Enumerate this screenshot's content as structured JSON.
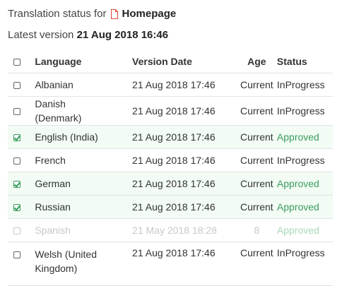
{
  "header": {
    "title_prefix": "Translation status for",
    "page_name": "Homepage",
    "latest_prefix": "Latest version",
    "latest_value": "21 Aug 2018 16:46"
  },
  "table": {
    "columns": {
      "language": "Language",
      "version_date": "Version Date",
      "age": "Age",
      "status": "Status"
    },
    "rows": [
      {
        "language": "Albanian",
        "date": "21 Aug 2018 17:46",
        "age": "Current",
        "status": "InProgress",
        "checked": false
      },
      {
        "language": "Danish (Denmark)",
        "date": "21 Aug 2018 17:46",
        "age": "Current",
        "status": "InProgress",
        "checked": false
      },
      {
        "language": "English (India)",
        "date": "21 Aug 2018 17:46",
        "age": "Current",
        "status": "Approved",
        "checked": true
      },
      {
        "language": "French",
        "date": "21 Aug 2018 17:46",
        "age": "Current",
        "status": "InProgress",
        "checked": false
      },
      {
        "language": "German",
        "date": "21 Aug 2018 17:46",
        "age": "Current",
        "status": "Approved",
        "checked": true
      },
      {
        "language": "Russian",
        "date": "21 Aug 2018 17:46",
        "age": "Current",
        "status": "Approved",
        "checked": true
      },
      {
        "language": "Spanish",
        "date": "21 May 2018 18:28",
        "age": "8",
        "status": "Approved",
        "checked": false
      },
      {
        "language": "Welsh (United Kingdom)",
        "date": "21 Aug 2018 17:46",
        "age": "Current",
        "status": "InProgress",
        "checked": false
      }
    ]
  },
  "colors": {
    "approved": "#3a9d5d",
    "page_icon": "#e0443a",
    "approved_row_bg": "#f2fbf4"
  }
}
